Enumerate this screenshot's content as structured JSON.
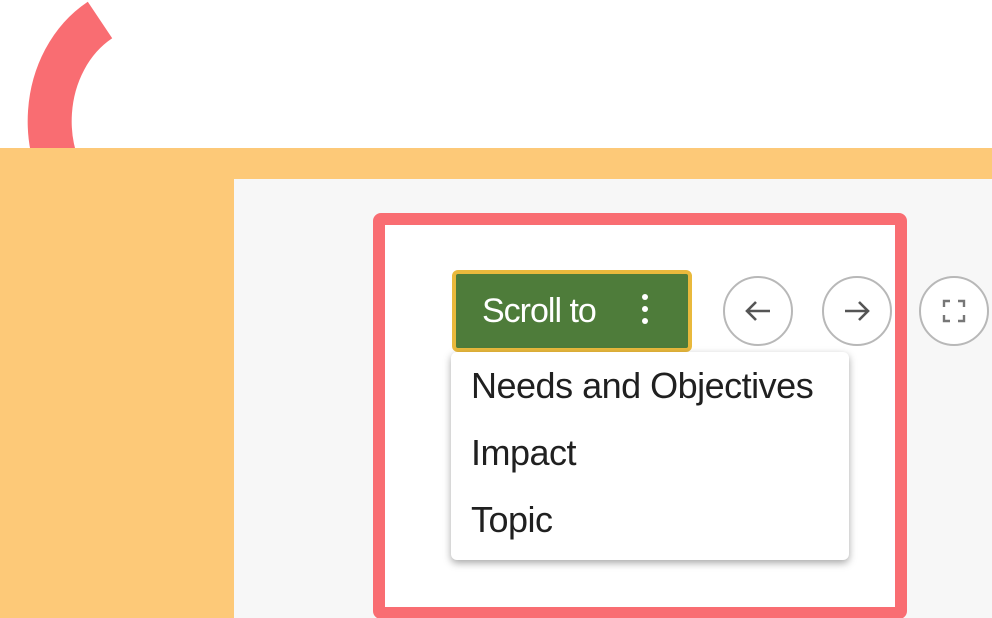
{
  "toolbar": {
    "scroll_button_label": "Scroll to",
    "scroll_button_icon": "kebab-menu-icon",
    "prev_icon": "arrow-left-icon",
    "next_icon": "arrow-right-icon",
    "fullscreen_icon": "expand-icon"
  },
  "dropdown": {
    "items": [
      {
        "label": "Needs and Objectives"
      },
      {
        "label": "Impact"
      },
      {
        "label": "Topic"
      }
    ]
  },
  "colors": {
    "band": "#fdc978",
    "panel": "#f7f7f7",
    "highlight": "#f96d72",
    "button_bg": "#4e7c3a",
    "button_border": "#e9b93c",
    "annotation_arrow": "#f96d72"
  }
}
